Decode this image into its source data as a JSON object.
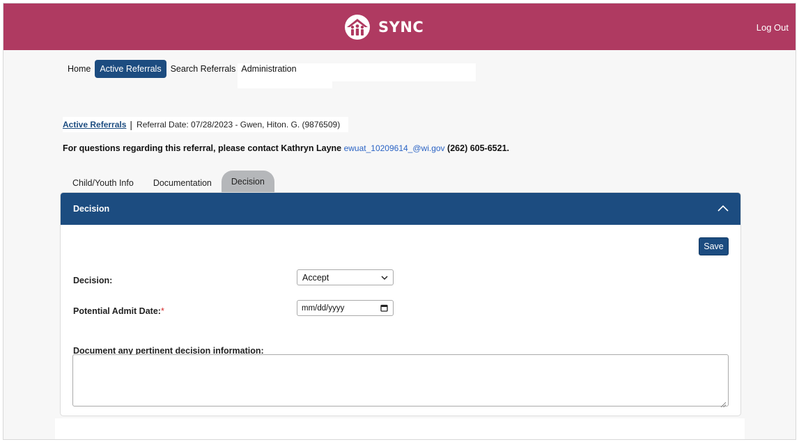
{
  "header": {
    "brand_name": "SYNC",
    "logout_label": "Log Out",
    "bg_color": "#af3a61",
    "logo_icon": "house-people-icon"
  },
  "nav": {
    "items": [
      {
        "label": "Home",
        "active": false
      },
      {
        "label": "Active Referrals",
        "active": true
      },
      {
        "label": "Search Referrals",
        "active": false
      },
      {
        "label": "Administration",
        "active": false
      }
    ]
  },
  "breadcrumb": {
    "link": "Active Referrals",
    "separator": "|",
    "details": "Referral Date: 07/28/2023 - Gwen, Hiton. G. (9876509)"
  },
  "contact": {
    "prefix": "For questions regarding this referral, please contact Kathryn Layne",
    "email": "ewuat_10209614_@wi.gov",
    "phone": "(262) 605-6521."
  },
  "tabs": [
    {
      "label": "Child/Youth Info",
      "active": false
    },
    {
      "label": "Documentation",
      "active": false
    },
    {
      "label": "Decision",
      "active": true
    }
  ],
  "panel": {
    "title": "Decision",
    "save_label": "Save",
    "decision_label": "Decision:",
    "decision_value": "Accept",
    "admit_label": "Potential Admit Date:",
    "admit_required": "*",
    "admit_placeholder": "mm/dd/yyyy",
    "notes_label": "Document any pertinent decision information:",
    "notes_value": ""
  },
  "colors": {
    "primary": "#1c4c80",
    "active_tab": "#b5b7ba",
    "link": "#2a63c4"
  }
}
